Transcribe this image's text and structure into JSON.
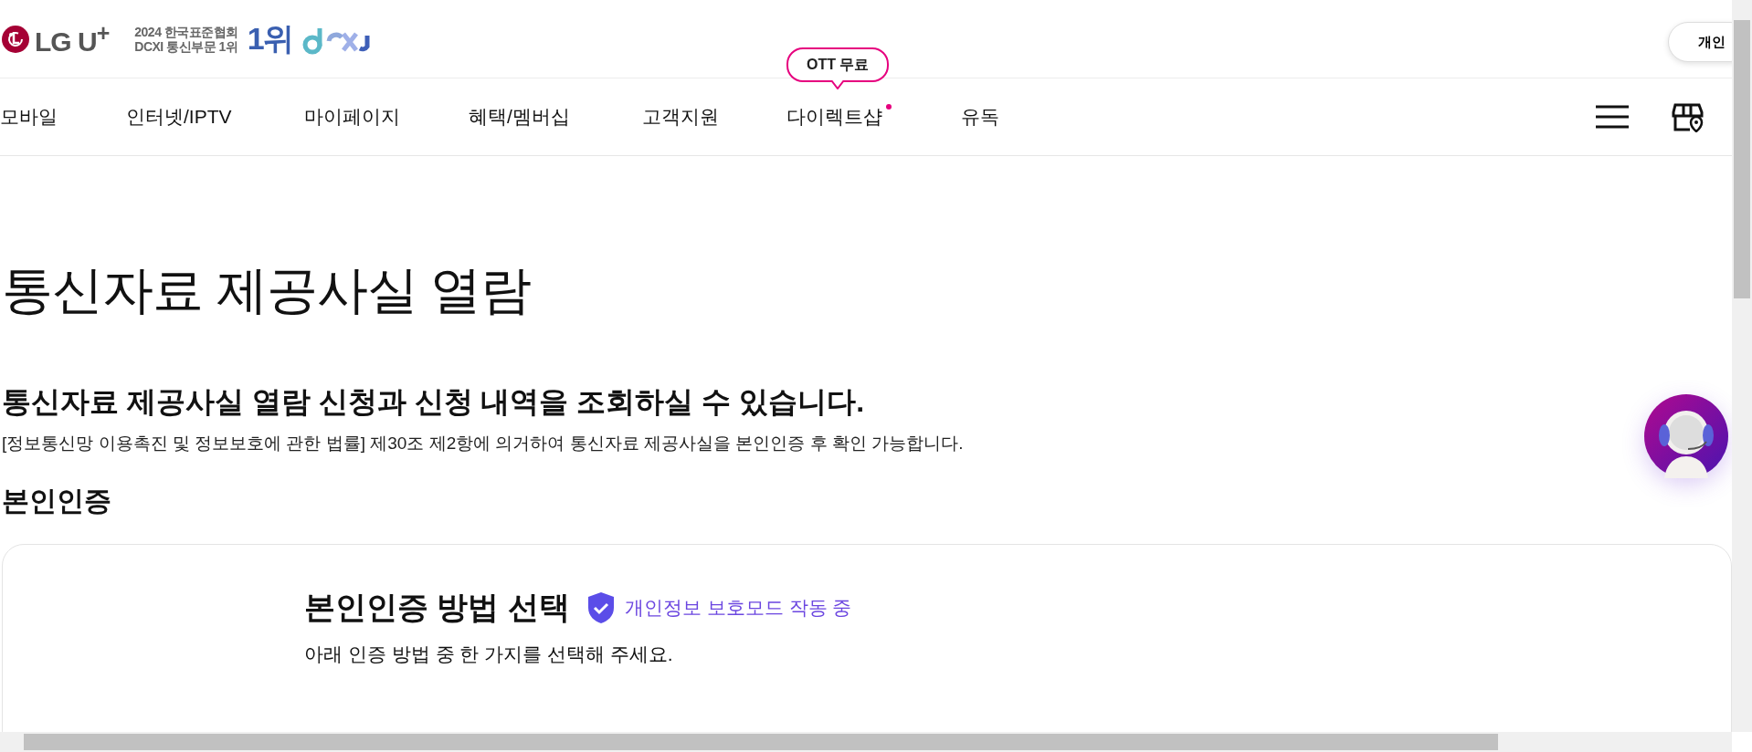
{
  "header": {
    "logo": "LG U$^{+}$",
    "award_lines": [
      "2024 한국표준협회",
      "DCXI 통신부문 1위"
    ],
    "award_rank": "1위",
    "top_button": "개인"
  },
  "nav": {
    "badge": "OTT 무료",
    "items": [
      {
        "label": "모바일",
        "new": false
      },
      {
        "label": "인터넷/IPTV",
        "new": false
      },
      {
        "label": "마이페이지",
        "new": false
      },
      {
        "label": "혜택/멤버십",
        "new": false
      },
      {
        "label": "고객지원",
        "new": false
      },
      {
        "label": "다이렉트샵",
        "new": true
      },
      {
        "label": "유독",
        "new": false
      }
    ]
  },
  "page": {
    "title": "통신자료 제공사실 열람",
    "subtitle": "통신자료 제공사실 열람 신청과 신청 내역을 조회하실 수 있습니다.",
    "description": "[정보통신망 이용촉진 및 정보보호에 관한 법률] 제30조 제2항에 의거하여 통신자료 제공사실을 본인인증 후 확인 가능합니다.",
    "section": "본인인증"
  },
  "card": {
    "heading": "본인인증 방법 선택",
    "privacy_mode": "개인정보 보호모드 작동 중",
    "instruction": "아래 인증 방법 중 한 가지를 선택해 주세요."
  }
}
